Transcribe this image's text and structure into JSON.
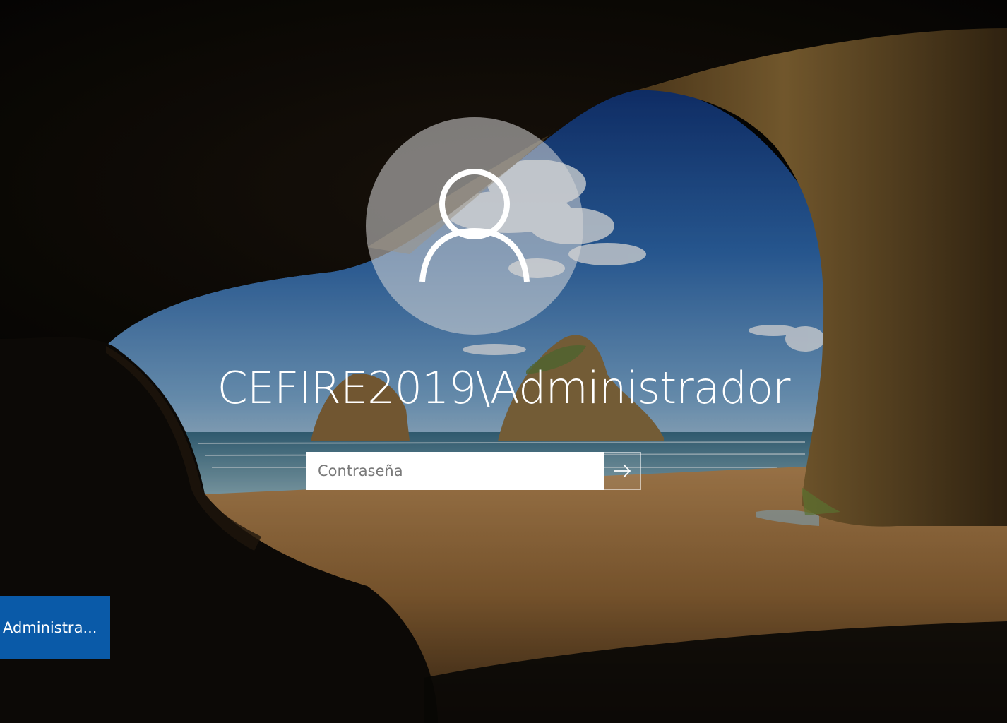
{
  "login": {
    "username": "CEFIRE2019\\Administrador",
    "password_placeholder": "Contraseña",
    "password_value": "",
    "submit_icon": "arrow-right-icon"
  },
  "avatar": {
    "icon": "user-icon"
  },
  "user_tiles": [
    {
      "label": "Administra..."
    }
  ],
  "colors": {
    "tile_accent": "#0a5aa8",
    "avatar_circle": "#d7d7d7",
    "text": "#ffffff"
  }
}
